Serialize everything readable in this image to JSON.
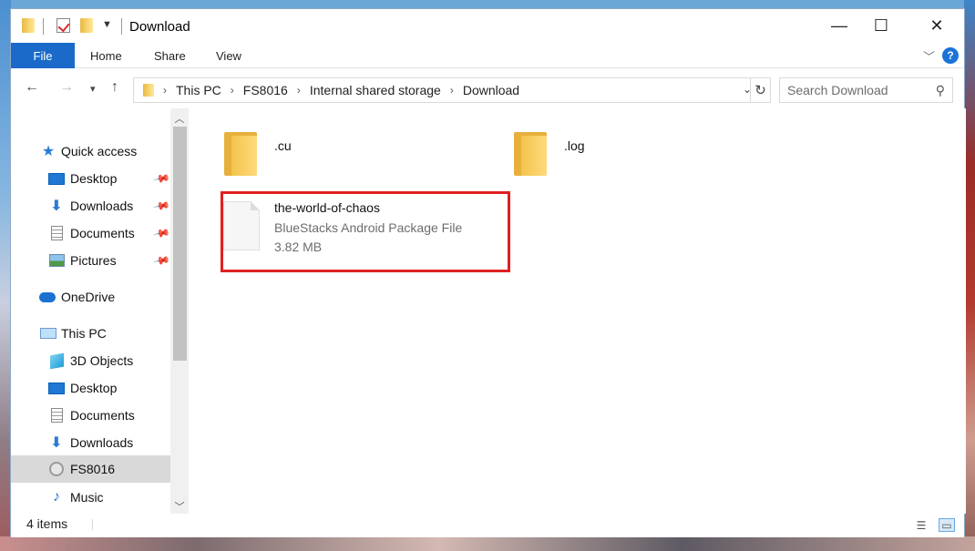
{
  "window": {
    "title": "Download"
  },
  "ribbon": {
    "tabs": [
      "File",
      "Home",
      "Share",
      "View"
    ]
  },
  "address": {
    "crumbs": [
      "This PC",
      "FS8016",
      "Internal shared storage",
      "Download"
    ]
  },
  "search": {
    "placeholder": "Search Download"
  },
  "sidebar": {
    "items": [
      {
        "label": "Quick access",
        "icon": "star-icon"
      },
      {
        "label": "Desktop",
        "icon": "desktop-icon",
        "pinned": true
      },
      {
        "label": "Downloads",
        "icon": "downloads-icon",
        "pinned": true
      },
      {
        "label": "Documents",
        "icon": "documents-icon",
        "pinned": true
      },
      {
        "label": "Pictures",
        "icon": "pictures-icon",
        "pinned": true
      },
      {
        "label": "OneDrive",
        "icon": "cloud-icon"
      },
      {
        "label": "This PC",
        "icon": "computer-icon"
      },
      {
        "label": "3D Objects",
        "icon": "cube-icon"
      },
      {
        "label": "Desktop",
        "icon": "desktop-icon"
      },
      {
        "label": "Documents",
        "icon": "documents-icon"
      },
      {
        "label": "Downloads",
        "icon": "downloads-icon"
      },
      {
        "label": "FS8016",
        "icon": "device-icon",
        "selected": true
      },
      {
        "label": "Music",
        "icon": "music-icon"
      }
    ]
  },
  "content": {
    "items": [
      {
        "name": ".cu",
        "type": "folder"
      },
      {
        "name": ".log",
        "type": "folder"
      },
      {
        "name": "the-world-of-chaos",
        "type": "file",
        "description": "BlueStacks Android Package File",
        "size": "3.82 MB"
      }
    ]
  },
  "status": {
    "count": "4 items"
  },
  "colors": {
    "accent": "#1b6ac9",
    "highlight": "#e02020",
    "folder": "#f3c54d"
  }
}
